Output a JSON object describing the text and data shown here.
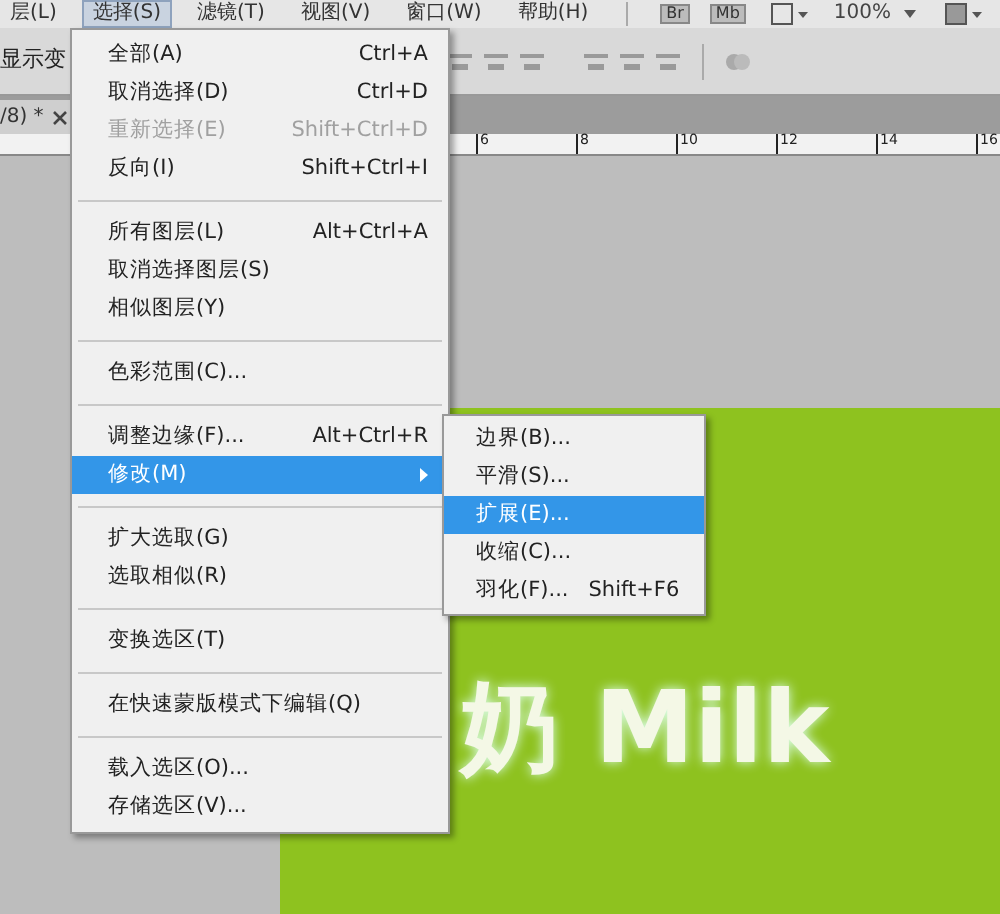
{
  "menubar": {
    "items": [
      {
        "label": "层(L)",
        "selected": false
      },
      {
        "label": "选择(S)",
        "selected": true
      },
      {
        "label": "滤镜(T)",
        "selected": false
      },
      {
        "label": "视图(V)",
        "selected": false
      },
      {
        "label": "窗口(W)",
        "selected": false
      },
      {
        "label": "帮助(H)",
        "selected": false
      }
    ],
    "badges": [
      "Br",
      "Mb"
    ],
    "zoom": "100%"
  },
  "options_bar": {
    "label": "显示变"
  },
  "document_tab": {
    "title": "/8) *"
  },
  "ruler": {
    "labels": [
      "6",
      "8",
      "10",
      "12",
      "14",
      "16"
    ]
  },
  "canvas": {
    "text": "奶 Milk"
  },
  "menu": {
    "items": [
      {
        "kind": "item",
        "label": "全部(A)",
        "shortcut": "Ctrl+A",
        "disabled": false,
        "selected": false
      },
      {
        "kind": "item",
        "label": "取消选择(D)",
        "shortcut": "Ctrl+D",
        "disabled": false,
        "selected": false
      },
      {
        "kind": "item",
        "label": "重新选择(E)",
        "shortcut": "Shift+Ctrl+D",
        "disabled": true,
        "selected": false
      },
      {
        "kind": "item",
        "label": "反向(I)",
        "shortcut": "Shift+Ctrl+I",
        "disabled": false,
        "selected": false
      },
      {
        "kind": "separator"
      },
      {
        "kind": "item",
        "label": "所有图层(L)",
        "shortcut": "Alt+Ctrl+A",
        "disabled": false,
        "selected": false
      },
      {
        "kind": "item",
        "label": "取消选择图层(S)",
        "disabled": false,
        "selected": false
      },
      {
        "kind": "item",
        "label": "相似图层(Y)",
        "disabled": false,
        "selected": false
      },
      {
        "kind": "separator"
      },
      {
        "kind": "item",
        "label": "色彩范围(C)...",
        "disabled": false,
        "selected": false
      },
      {
        "kind": "separator"
      },
      {
        "kind": "item",
        "label": "调整边缘(F)...",
        "shortcut": "Alt+Ctrl+R",
        "disabled": false,
        "selected": false
      },
      {
        "kind": "submenu",
        "label": "修改(M)",
        "disabled": false,
        "selected": true
      },
      {
        "kind": "separator"
      },
      {
        "kind": "item",
        "label": "扩大选取(G)",
        "disabled": false,
        "selected": false
      },
      {
        "kind": "item",
        "label": "选取相似(R)",
        "disabled": false,
        "selected": false
      },
      {
        "kind": "separator"
      },
      {
        "kind": "item",
        "label": "变换选区(T)",
        "disabled": false,
        "selected": false
      },
      {
        "kind": "separator"
      },
      {
        "kind": "item",
        "label": "在快速蒙版模式下编辑(Q)",
        "disabled": false,
        "selected": false
      },
      {
        "kind": "separator"
      },
      {
        "kind": "item",
        "label": "载入选区(O)...",
        "disabled": false,
        "selected": false
      },
      {
        "kind": "item",
        "label": "存储选区(V)...",
        "disabled": false,
        "selected": false
      }
    ]
  },
  "submenu": {
    "items": [
      {
        "label": "边界(B)...",
        "selected": false
      },
      {
        "label": "平滑(S)...",
        "selected": false
      },
      {
        "label": "扩展(E)...",
        "selected": true
      },
      {
        "label": "收缩(C)...",
        "selected": false
      },
      {
        "label": "羽化(F)...",
        "shortcut": "Shift+F6",
        "selected": false
      }
    ]
  }
}
